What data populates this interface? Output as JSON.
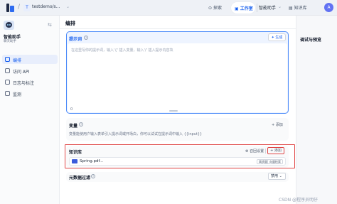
{
  "topbar": {
    "app_chip": "T",
    "app_name": "testdemo/s...",
    "nav": {
      "explore": "探索",
      "studio": "工作室",
      "assistant": "智能助手",
      "knowledge": "知识库"
    },
    "user_initial": "A"
  },
  "sidebar": {
    "app_title": "智能助手",
    "app_type": "聊天助手",
    "items": [
      {
        "label": "编排",
        "active": true
      },
      {
        "label": "访问 API",
        "active": false
      },
      {
        "label": "日志与标注",
        "active": false
      },
      {
        "label": "监测",
        "active": false
      }
    ]
  },
  "main": {
    "page_title": "编排",
    "prompt": {
      "label": "提示词",
      "generate_label": "生成",
      "placeholder": "在这里写你的提示词，输入'{' 插入变量，输入'/' 插入提示内容块",
      "count": "0"
    },
    "variables": {
      "title": "变量",
      "add_label": "+ 添加",
      "desc": "变量能使用户输入表单引入提示词或开场白，你可以试试在提示词中输入 {{input}}"
    },
    "knowledge": {
      "title": "知识库",
      "recall_label": "召回设置",
      "add_label": "+ 添加",
      "file_name": "Spring.pdf...",
      "tag1": "高质量",
      "tag2": "向量检索"
    },
    "metadata": {
      "title": "元数据过滤",
      "select_value": "禁用"
    }
  },
  "right": {
    "title": "调试与预览"
  },
  "watermark": "CSDN @程序员明仔",
  "colors": {
    "accent": "#155eef",
    "highlight": "#e04545"
  }
}
